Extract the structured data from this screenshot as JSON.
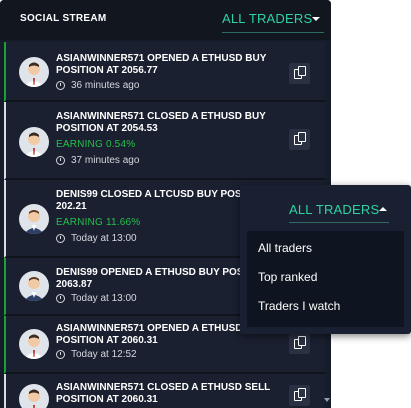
{
  "header": {
    "title": "SOCIAL STREAM",
    "filter_label": "ALL TRADERS"
  },
  "items": [
    {
      "message_line1": "ASIANWINNER571 OPENED A ETHUSD BUY",
      "message_line2": "POSITION AT 2056.77",
      "earning": "",
      "time": "36 minutes ago"
    },
    {
      "message_line1": "ASIANWINNER571 CLOSED A ETHUSD BUY",
      "message_line2": "POSITION AT 2054.53",
      "earning": "EARNING 0.54%",
      "time": "37 minutes ago"
    },
    {
      "message_line1": "DENIS99 CLOSED A LTCUSD BUY POSITION AT",
      "message_line2": "202.21",
      "earning": "EARNING 11.66%",
      "time": "Today at 13:00"
    },
    {
      "message_line1": "DENIS99 OPENED A ETHUSD BUY POSITION AT",
      "message_line2": "2063.87",
      "earning": "",
      "time": "Today at 13:00"
    },
    {
      "message_line1": "ASIANWINNER571 OPENED A ETHUSD BUY",
      "message_line2": "POSITION AT 2060.31",
      "earning": "",
      "time": "Today at 12:52"
    },
    {
      "message_line1": "ASIANWINNER571 CLOSED A ETHUSD SELL",
      "message_line2": "POSITION AT 2060.31",
      "earning": "",
      "time": ""
    }
  ],
  "dropdown": {
    "toggle_label": "ALL TRADERS",
    "options": [
      "All traders",
      "Top ranked",
      "Traders I watch"
    ]
  },
  "colors": {
    "accent": "#2fd3a2",
    "earning": "#23c14a",
    "panel_bg": "#171c2b"
  }
}
